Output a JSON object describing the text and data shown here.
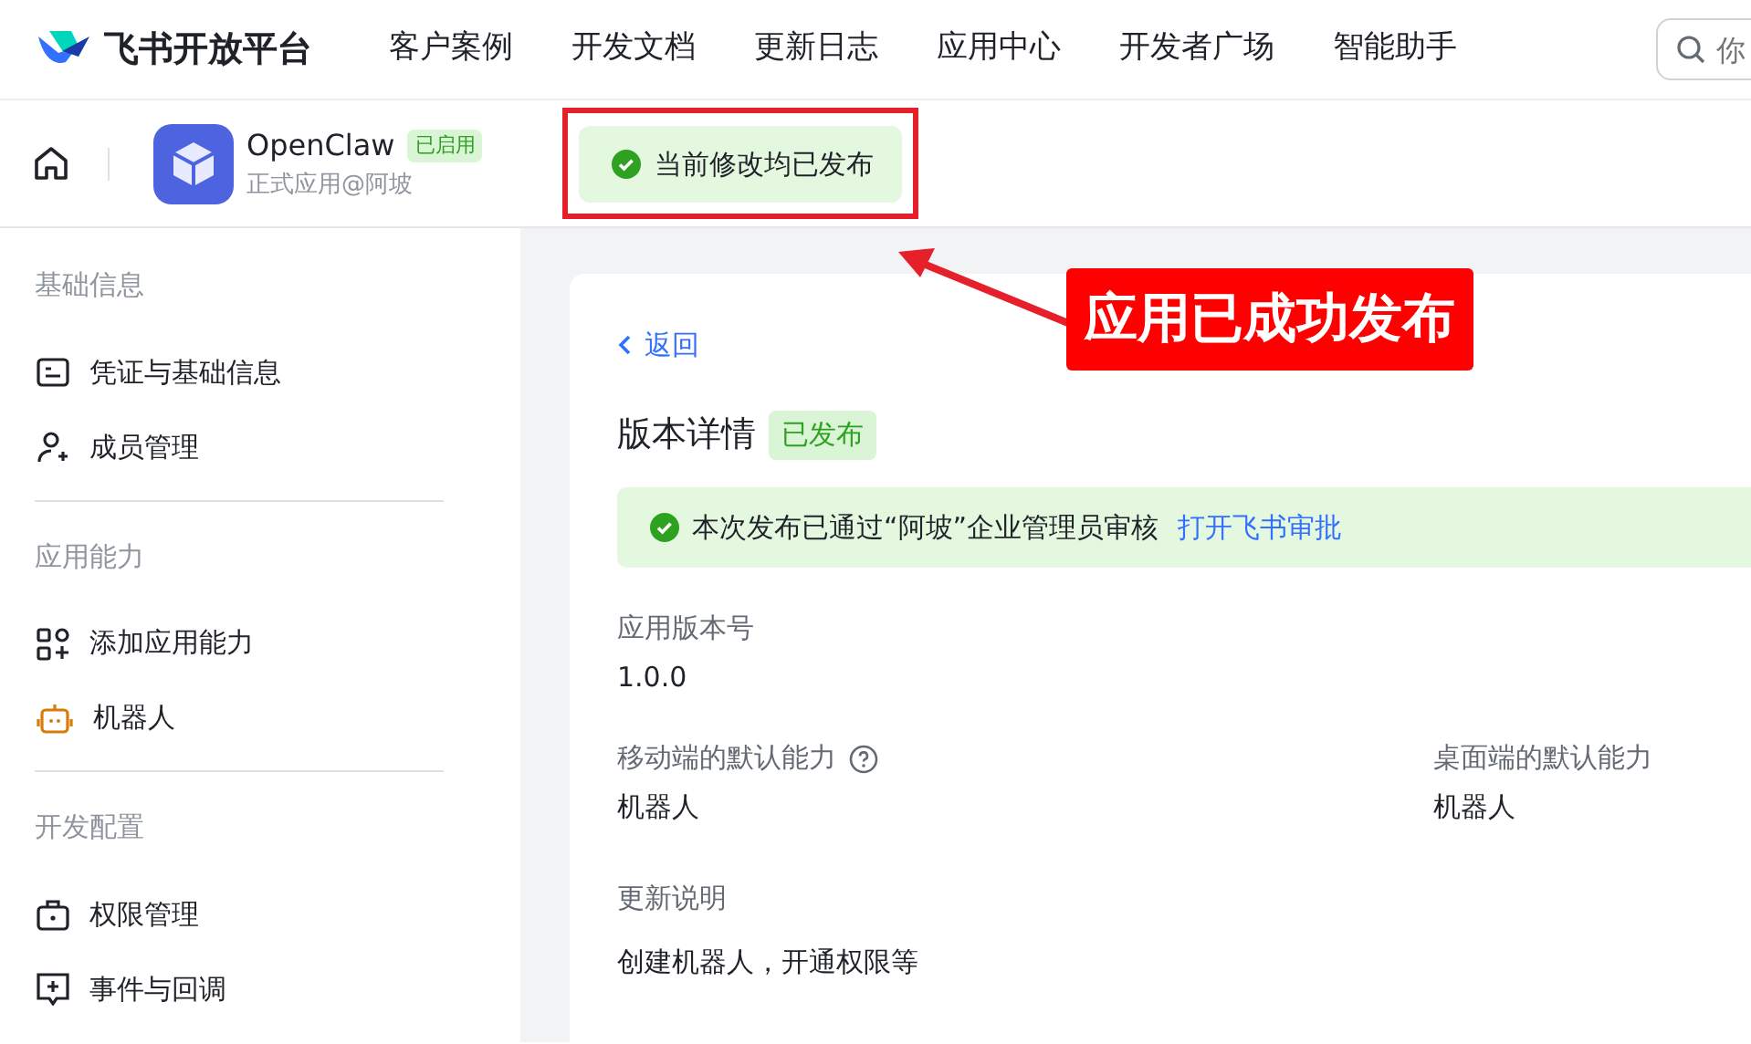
{
  "top_nav": {
    "logo_text": "飞书开放平台",
    "links": [
      "客户案例",
      "开发文档",
      "更新日志",
      "应用中心",
      "开发者广场",
      "智能助手"
    ],
    "search": {
      "placeholder": "你"
    }
  },
  "app_bar": {
    "app_name": "OpenClaw",
    "status_badge": "已启用",
    "subtitle": "正式应用@阿坡",
    "toast": "当前修改均已发布"
  },
  "annotation": {
    "text": "应用已成功发布"
  },
  "sidebar": {
    "sections": [
      {
        "title": "基础信息",
        "items": [
          {
            "label": "凭证与基础信息",
            "kind": "card"
          },
          {
            "label": "成员管理",
            "kind": "member"
          }
        ]
      },
      {
        "title": "应用能力",
        "items": [
          {
            "label": "添加应用能力",
            "kind": "apps"
          },
          {
            "label": "机器人",
            "kind": "robot"
          }
        ]
      },
      {
        "title": "开发配置",
        "items": [
          {
            "label": "权限管理",
            "kind": "lock"
          },
          {
            "label": "事件与回调",
            "kind": "event"
          }
        ]
      }
    ]
  },
  "content": {
    "back_link": "返回",
    "title": "版本详情",
    "status_badge": "已发布",
    "notice": {
      "text": "本次发布已通过“阿坡”企业管理员审核",
      "link": "打开飞书审批"
    },
    "version": {
      "label": "应用版本号",
      "value": "1.0.0"
    },
    "mobile_default": {
      "label": "移动端的默认能力",
      "value": "机器人"
    },
    "desktop_default": {
      "label": "桌面端的默认能力",
      "value": "机器人"
    },
    "update_notes": {
      "label": "更新说明",
      "value": "创建机器人，开通权限等"
    }
  }
}
